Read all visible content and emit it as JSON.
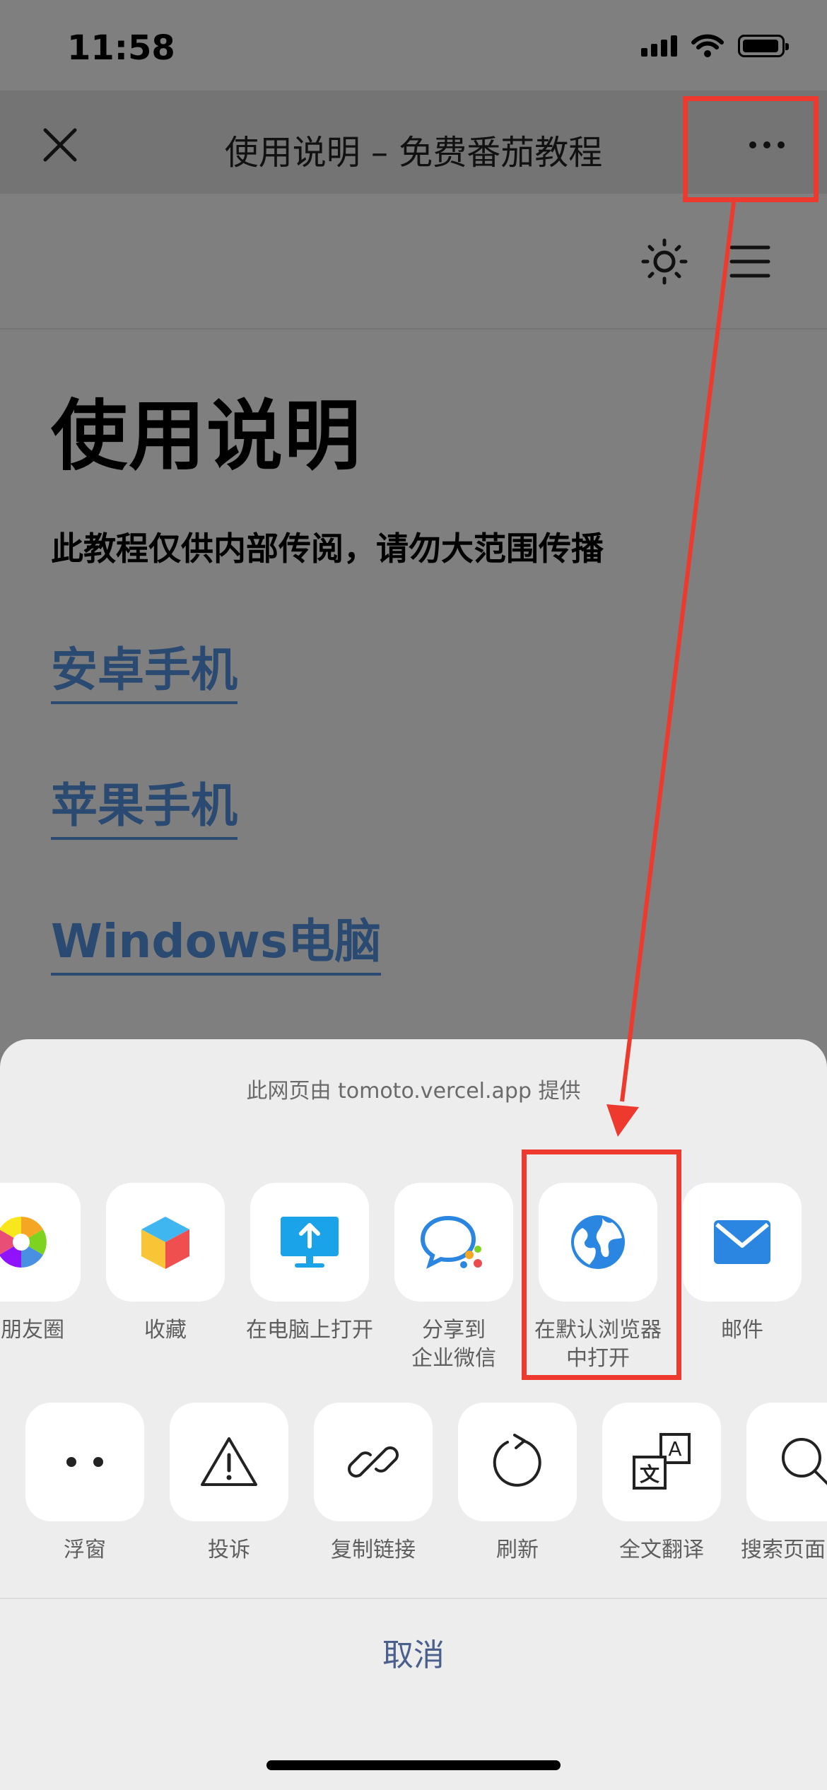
{
  "status_bar": {
    "time": "11:58"
  },
  "nav": {
    "title": "使用说明 – 免费番茄教程"
  },
  "page": {
    "heading": "使用说明",
    "note": "此教程仅供内部传阅，请勿大范围传播",
    "links": [
      "安卓手机",
      "苹果手机",
      "Windows电脑"
    ]
  },
  "sheet": {
    "provider": "此网页由 tomoto.vercel.app 提供",
    "share_row": [
      {
        "label": "到朋友圈",
        "icon": "moments-icon"
      },
      {
        "label": "收藏",
        "icon": "favorites-cube-icon"
      },
      {
        "label": "在电脑上打开",
        "icon": "open-on-pc-icon"
      },
      {
        "label": "分享到\n企业微信",
        "icon": "wecom-icon"
      },
      {
        "label": "在默认浏览器\n中打开",
        "icon": "globe-icon"
      },
      {
        "label": "邮件",
        "icon": "mail-icon"
      }
    ],
    "action_row": [
      {
        "label": "浮窗",
        "icon": "float-window-icon"
      },
      {
        "label": "投诉",
        "icon": "warning-icon"
      },
      {
        "label": "复制链接",
        "icon": "link-icon"
      },
      {
        "label": "刷新",
        "icon": "refresh-icon"
      },
      {
        "label": "全文翻译",
        "icon": "translate-icon"
      },
      {
        "label": "搜索页面",
        "icon": "search-icon"
      }
    ],
    "cancel": "取消"
  },
  "colors": {
    "annotation": "#ee3a2e",
    "link": "#2a4a72",
    "cancel": "#4a5f8c"
  }
}
